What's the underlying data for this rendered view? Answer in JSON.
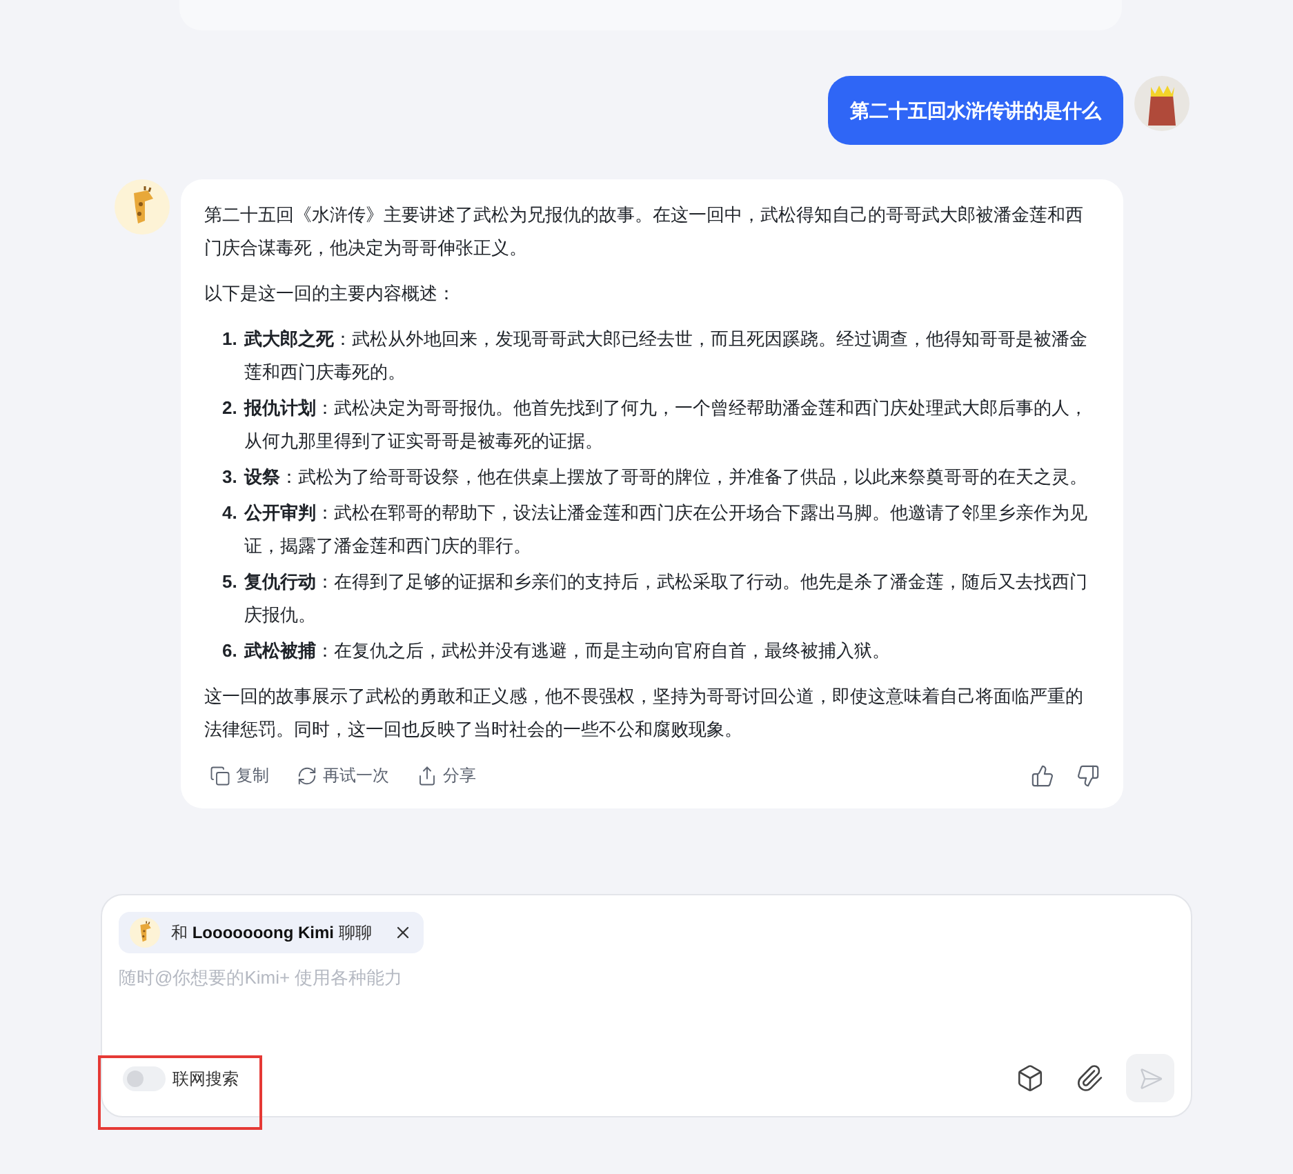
{
  "user_message": {
    "text": "第二十五回水浒传讲的是什么"
  },
  "assistant_message": {
    "intro": "第二十五回《水浒传》主要讲述了武松为兄报仇的故事。在这一回中，武松得知自己的哥哥武大郎被潘金莲和西门庆合谋毒死，他决定为哥哥伸张正义。",
    "lead": "以下是这一回的主要内容概述：",
    "items": [
      {
        "number": "1.",
        "title": "武大郎之死",
        "body": "：武松从外地回来，发现哥哥武大郎已经去世，而且死因蹊跷。经过调查，他得知哥哥是被潘金莲和西门庆毒死的。"
      },
      {
        "number": "2.",
        "title": "报仇计划",
        "body": "：武松决定为哥哥报仇。他首先找到了何九，一个曾经帮助潘金莲和西门庆处理武大郎后事的人，从何九那里得到了证实哥哥是被毒死的证据。"
      },
      {
        "number": "3.",
        "title": "设祭",
        "body": "：武松为了给哥哥设祭，他在供桌上摆放了哥哥的牌位，并准备了供品，以此来祭奠哥哥的在天之灵。"
      },
      {
        "number": "4.",
        "title": "公开审判",
        "body": "：武松在郓哥的帮助下，设法让潘金莲和西门庆在公开场合下露出马脚。他邀请了邻里乡亲作为见证，揭露了潘金莲和西门庆的罪行。"
      },
      {
        "number": "5.",
        "title": "复仇行动",
        "body": "：在得到了足够的证据和乡亲们的支持后，武松采取了行动。他先是杀了潘金莲，随后又去找西门庆报仇。"
      },
      {
        "number": "6.",
        "title": "武松被捕",
        "body": "：在复仇之后，武松并没有逃避，而是主动向官府自首，最终被捕入狱。"
      }
    ],
    "conclusion": "这一回的故事展示了武松的勇敢和正义感，他不畏强权，坚持为哥哥讨回公道，即使这意味着自己将面临严重的法律惩罚。同时，这一回也反映了当时社会的一些不公和腐败现象。",
    "actions": [
      "复制",
      "再试一次",
      "分享"
    ]
  },
  "composer": {
    "chip": {
      "prefix": "和",
      "name": "Looooooong Kimi",
      "suffix": "聊聊"
    },
    "placeholder": "随时@你想要的Kimi+ 使用各种能力",
    "web_search": {
      "label": "联网搜索",
      "on": false
    },
    "highlighted": true
  }
}
